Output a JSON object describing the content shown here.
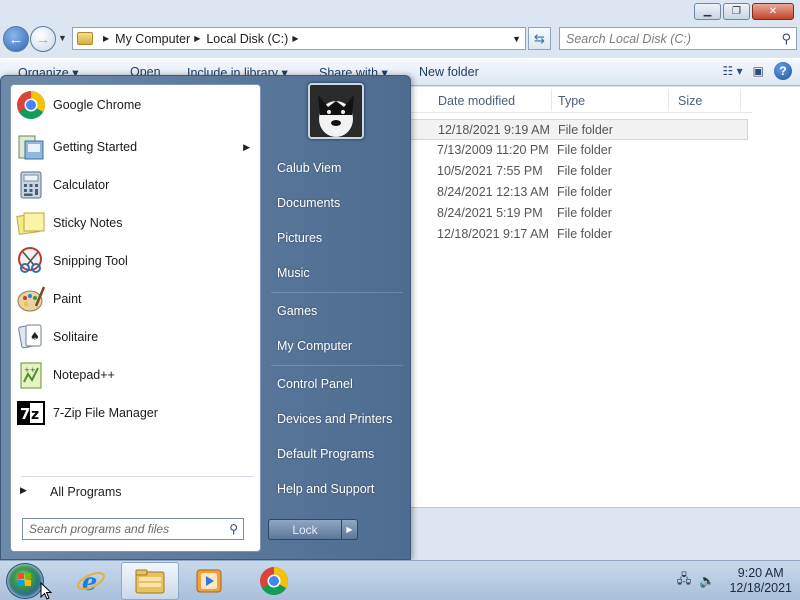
{
  "explorer": {
    "address": {
      "parts": [
        "My Computer",
        "Local Disk (C:)"
      ]
    },
    "search_placeholder": "Search Local Disk (C:)",
    "toolbar": {
      "organize": "Organize ▾",
      "open": "Open",
      "include": "Include in library ▾",
      "share": "Share with ▾",
      "new_folder": "New folder"
    },
    "columns": {
      "date": "Date modified",
      "type": "Type",
      "size": "Size"
    },
    "files": [
      {
        "date": "12/18/2021 9:19 AM",
        "type": "File folder"
      },
      {
        "date": "7/13/2009 11:20 PM",
        "type": "File folder"
      },
      {
        "date": "10/5/2021 7:55 PM",
        "type": "File folder"
      },
      {
        "date": "8/24/2021 12:13 AM",
        "type": "File folder"
      },
      {
        "date": "8/24/2021 5:19 PM",
        "type": "File folder"
      },
      {
        "date": "12/18/2021 9:17 AM",
        "type": "File folder"
      }
    ]
  },
  "start_menu": {
    "programs": [
      {
        "label": "Google Chrome",
        "icon": "chrome-icon"
      },
      {
        "label": "Getting Started",
        "icon": "getting-started-icon"
      },
      {
        "label": "Calculator",
        "icon": "calculator-icon"
      },
      {
        "label": "Sticky Notes",
        "icon": "sticky-notes-icon"
      },
      {
        "label": "Snipping Tool",
        "icon": "snipping-tool-icon"
      },
      {
        "label": "Paint",
        "icon": "paint-icon"
      },
      {
        "label": "Solitaire",
        "icon": "solitaire-icon"
      },
      {
        "label": "Notepad++",
        "icon": "notepadpp-icon"
      },
      {
        "label": "7-Zip File Manager",
        "icon": "7zip-icon"
      }
    ],
    "all_programs": "All Programs",
    "search_placeholder": "Search programs and files",
    "right_items": [
      "Calub Viem",
      "Documents",
      "Pictures",
      "Music",
      "Games",
      "My Computer",
      "Control Panel",
      "Devices and Printers",
      "Default Programs",
      "Help and Support"
    ],
    "lock_label": "Lock"
  },
  "taskbar": {
    "apps": [
      "internet-explorer-icon",
      "explorer-icon",
      "media-player-icon",
      "chrome-icon"
    ],
    "time": "9:20 AM",
    "date": "12/18/2021"
  }
}
